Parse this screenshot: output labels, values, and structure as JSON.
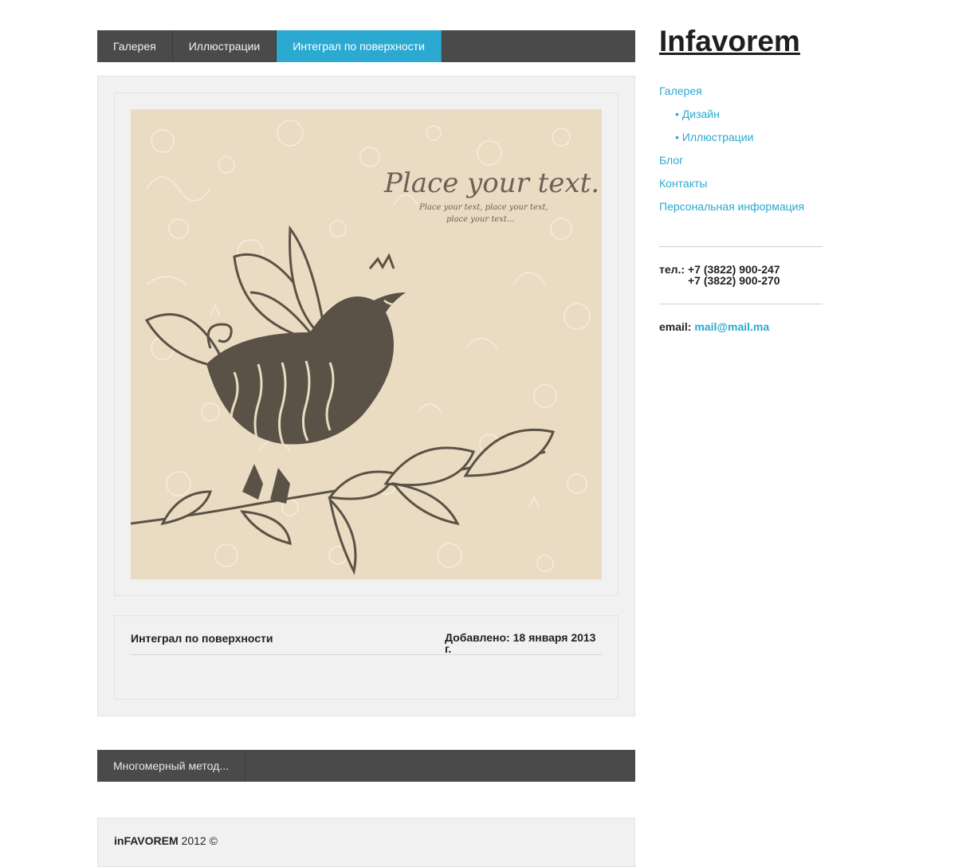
{
  "nav": {
    "items": [
      {
        "label": "Галерея"
      },
      {
        "label": "Иллюстрации"
      },
      {
        "label": "Интеграл по поверхности",
        "active": true
      }
    ]
  },
  "post": {
    "image_text": {
      "headline": "Place your text...",
      "line1": "Place your text, place your text,",
      "line2": "place your text..."
    },
    "title": "Интеграл по поверхности",
    "date": "Добавлено: 18 января 2013 г."
  },
  "next": {
    "label": "Многомерный метод..."
  },
  "footer": {
    "brand": "inFAVOREM",
    "year": "2012 ©"
  },
  "sidebar": {
    "site_title": "Infavorem",
    "menu": [
      {
        "label": "Галерея",
        "sub": false
      },
      {
        "label": "Дизайн",
        "sub": true
      },
      {
        "label": "Иллюстрации",
        "sub": true
      },
      {
        "label": "Блог",
        "sub": false
      },
      {
        "label": "Контакты",
        "sub": false
      },
      {
        "label": "Персональная информация",
        "sub": false
      }
    ],
    "phone_label": "тел.:",
    "phone1": "+7 (3822) 900-247",
    "phone2": "+7 (3822) 900-270",
    "email_label": "email:",
    "email": "mail@mail.ma"
  },
  "colors": {
    "accent": "#2ba9d1",
    "nav_bg": "#4a4a4a",
    "panel_bg": "#f1f1f1",
    "art_bg": "#e9dcc2",
    "bird": "#5b5247"
  }
}
